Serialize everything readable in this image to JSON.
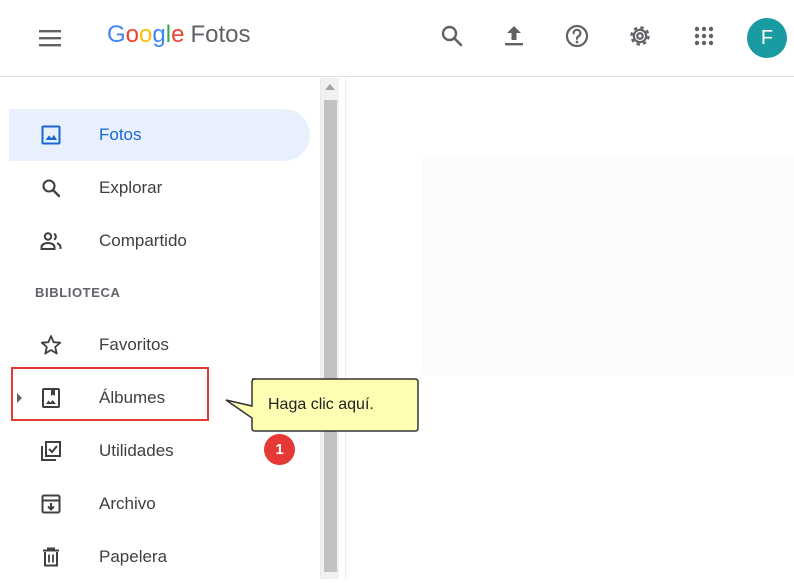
{
  "header": {
    "logo_letters": [
      "G",
      "o",
      "o",
      "g",
      "l",
      "e"
    ],
    "product": "Fotos",
    "avatar_initial": "F",
    "colors": {
      "avatar": "#1a9ba1",
      "accent": "#1967d2",
      "active_bg": "#e8f0fe"
    }
  },
  "sidebar": {
    "items": [
      {
        "label": "Fotos",
        "icon": "photo-icon",
        "active": true
      },
      {
        "label": "Explorar",
        "icon": "search-icon"
      },
      {
        "label": "Compartido",
        "icon": "people-icon"
      }
    ],
    "section_label": "BIBLIOTECA",
    "library_items": [
      {
        "label": "Favoritos",
        "icon": "star-icon"
      },
      {
        "label": "Álbumes",
        "icon": "album-icon"
      },
      {
        "label": "Utilidades",
        "icon": "utilities-icon"
      },
      {
        "label": "Archivo",
        "icon": "archive-icon"
      },
      {
        "label": "Papelera",
        "icon": "trash-icon"
      }
    ]
  },
  "annotation": {
    "callout_text": "Haga clic aquí.",
    "step_number": "1",
    "colors": {
      "highlight": "#e53935",
      "callout_bg": "#ffffb4"
    }
  }
}
